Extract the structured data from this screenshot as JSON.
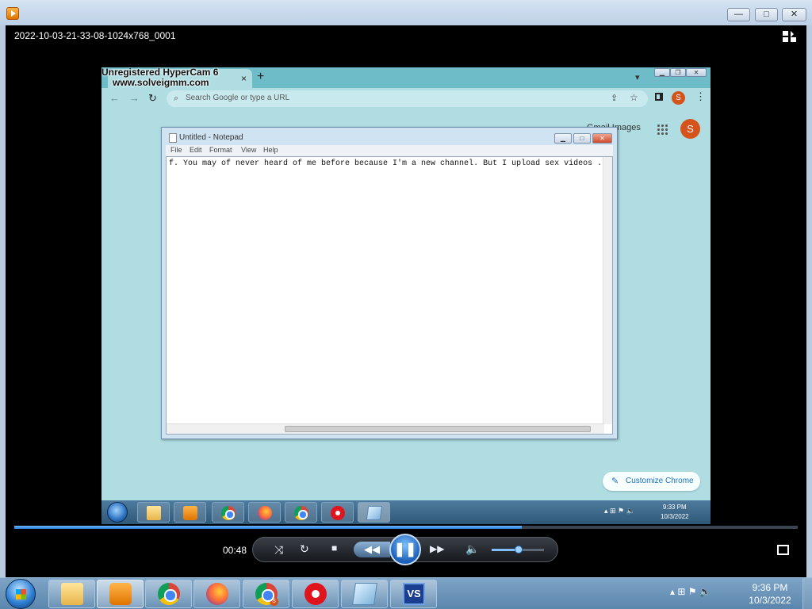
{
  "window": {
    "title": "2022-10-03-21-33-08-1024x768_0001",
    "buttons": {
      "minimize": "—",
      "maximize": "□",
      "close": "✕"
    }
  },
  "video": {
    "watermark_line1": "Unregistered HyperCam 6",
    "watermark_line2": "www.solveigmm.com",
    "chrome": {
      "tab_close": "×",
      "new_tab": "+",
      "omnibox_placeholder": "Search Google or type a URL",
      "profile_initial": "S",
      "page_link": "Gmail Images",
      "avatar_initial": "S",
      "customize_label": "Customize Chrome"
    },
    "notepad": {
      "title": "Untitled - Notepad",
      "menu": [
        "File",
        "Edit",
        "Format",
        "View",
        "Help"
      ],
      "text": "f. You may of never heard of me before because I'm a new channel. But I upload sex videos ."
    },
    "taskbar": {
      "time": "9:33 PM",
      "date": "10/3/2022"
    }
  },
  "player": {
    "elapsed": "00:48",
    "progress": 0.648,
    "volume": 0.52,
    "playing": true
  },
  "taskbar": {
    "time": "9:36 PM",
    "date": "10/3/2022",
    "vs_label": "VS",
    "chrome_badge": "S"
  },
  "colors": {
    "video_bg": "#afdde2",
    "accent": "#2a7ad6",
    "profile": "#d4541c"
  }
}
